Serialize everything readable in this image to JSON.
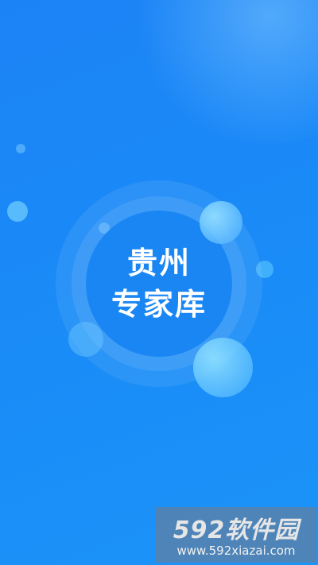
{
  "splash": {
    "title_line1": "贵州",
    "title_line2": "专家库"
  },
  "watermark": {
    "brand": "592软件园",
    "url": "www.592xiazai.com"
  },
  "colors": {
    "background": "#1a88f6",
    "circle_fill": "#1a86f4",
    "text": "#ffffff"
  }
}
